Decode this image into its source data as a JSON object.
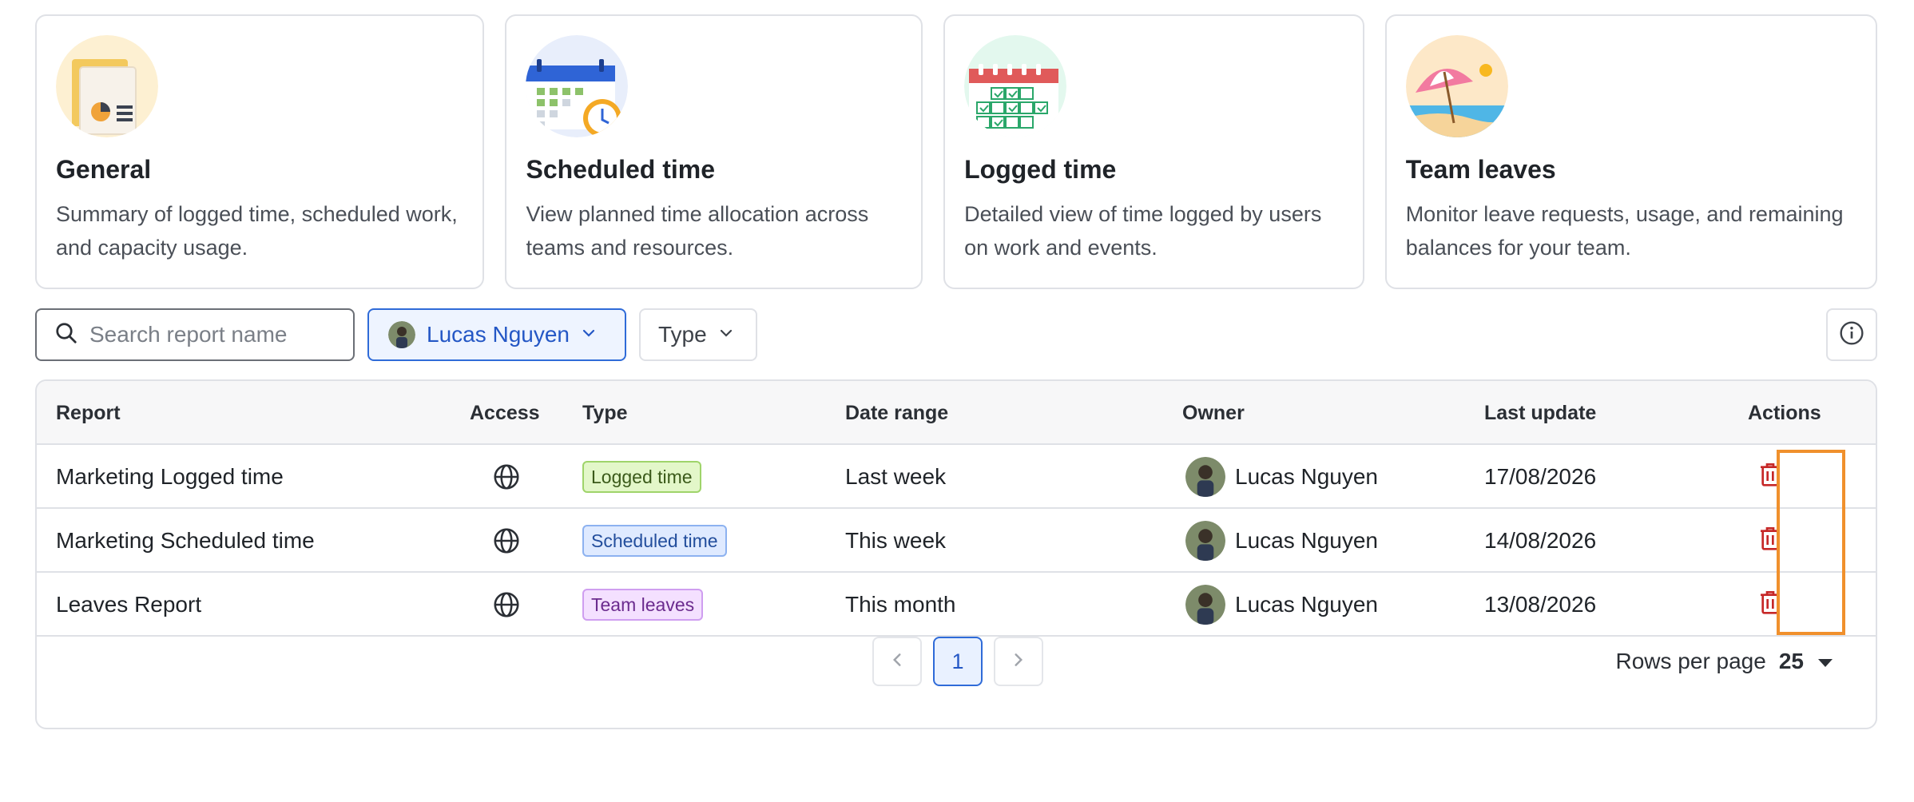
{
  "cards": [
    {
      "title": "General",
      "desc": "Summary of logged time, scheduled work, and capacity usage.",
      "illustration": "report-documents-illustration"
    },
    {
      "title": "Scheduled time",
      "desc": "View planned time allocation across teams and resources.",
      "illustration": "calendar-clock-illustration"
    },
    {
      "title": "Logged time",
      "desc": "Detailed view of time logged by users on work and events.",
      "illustration": "calendar-check-illustration"
    },
    {
      "title": "Team leaves",
      "desc": "Monitor leave requests, usage, and remaining balances for your team.",
      "illustration": "beach-umbrella-illustration"
    }
  ],
  "toolbar": {
    "search_placeholder": "Search report name",
    "owner_filter_label": "Lucas Nguyen",
    "type_filter_label": "Type"
  },
  "table": {
    "headers": {
      "report": "Report",
      "access": "Access",
      "type": "Type",
      "date_range": "Date range",
      "owner": "Owner",
      "last_update": "Last update",
      "actions": "Actions"
    },
    "rows": [
      {
        "report": "Marketing Logged time",
        "access_icon": "globe-icon",
        "type": "Logged time",
        "date_range": "Last week",
        "owner": "Lucas Nguyen",
        "last_update": "17/08/2026"
      },
      {
        "report": "Marketing Scheduled time",
        "access_icon": "globe-icon",
        "type": "Scheduled time",
        "date_range": "This week",
        "owner": "Lucas Nguyen",
        "last_update": "14/08/2026"
      },
      {
        "report": "Leaves Report",
        "access_icon": "globe-icon",
        "type": "Team leaves",
        "date_range": "This month",
        "owner": "Lucas Nguyen",
        "last_update": "13/08/2026"
      }
    ]
  },
  "pagination": {
    "current_page": "1",
    "rows_per_page_label": "Rows per page",
    "rows_per_page_value": "25"
  },
  "colors": {
    "accent_blue": "#2f6bd8",
    "delete_red": "#c62828",
    "highlight_orange": "#f0902c",
    "badge_logged_bg": "#e3f7c9",
    "badge_scheduled_bg": "#dfeaff",
    "badge_leaves_bg": "#f4e0ff"
  }
}
